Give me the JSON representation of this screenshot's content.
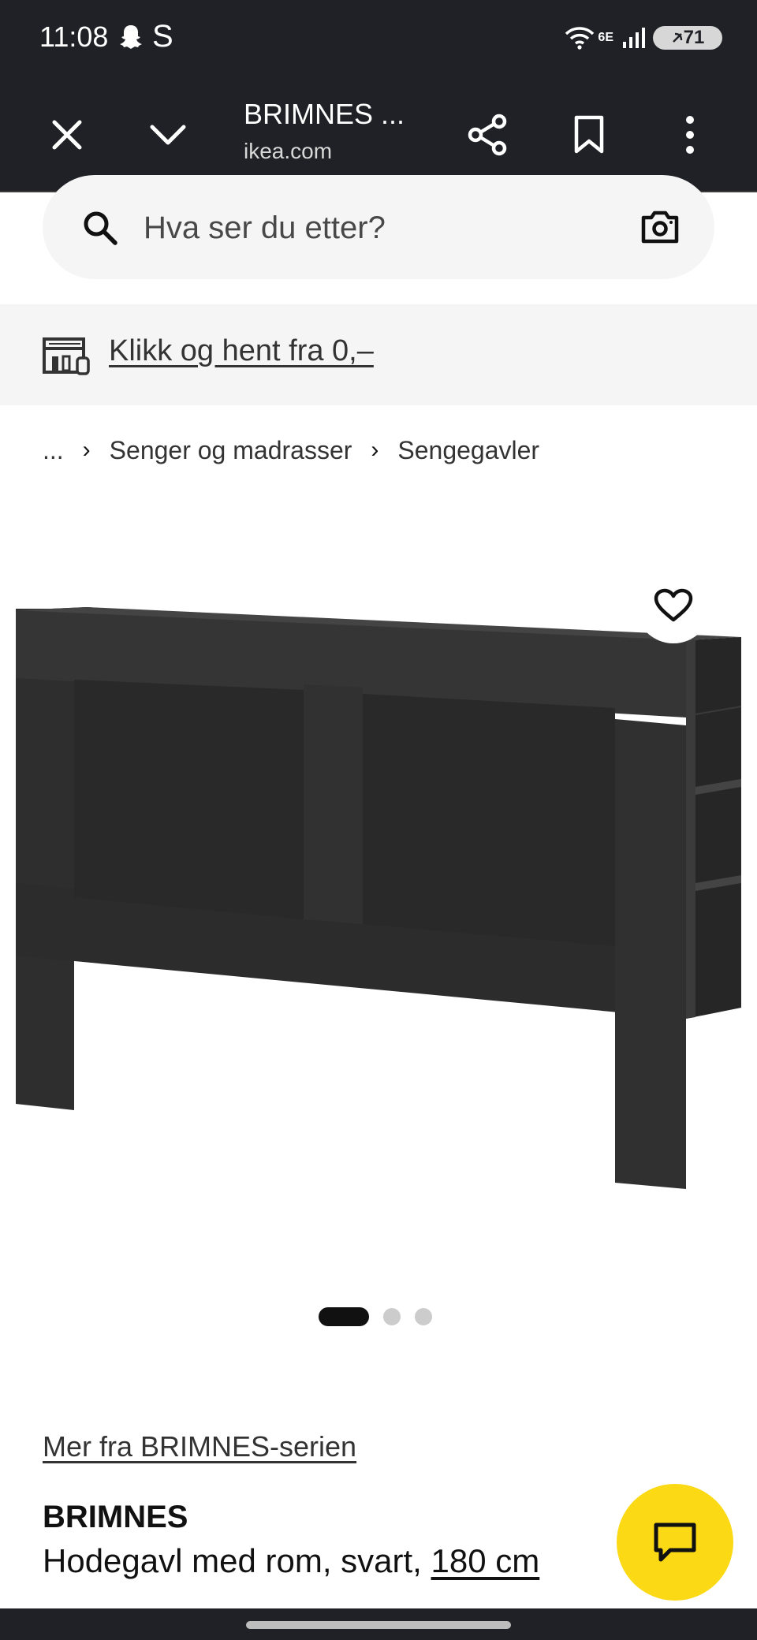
{
  "status_bar": {
    "time": "11:08",
    "s_label": "S",
    "network": "6E",
    "battery": "71"
  },
  "toolbar": {
    "title": "BRIMNES ...",
    "url": "ikea.com"
  },
  "search": {
    "placeholder": "Hva ser du etter?"
  },
  "promo": {
    "link_text": "Klikk og hent fra 0,–"
  },
  "breadcrumb": {
    "ellipsis": "...",
    "items": [
      "Senger og madrasser",
      "Sengegavler"
    ]
  },
  "gallery": {
    "pages": 3,
    "current": 1
  },
  "product": {
    "series_link": "Mer fra BRIMNES-serien",
    "name": "BRIMNES",
    "description": "Hodegavl med rom, svart, ",
    "size": "180 cm"
  },
  "colors": {
    "chrome": "#1f2126",
    "accent_yellow": "#fbd914",
    "product_black": "#2e2e2e"
  }
}
